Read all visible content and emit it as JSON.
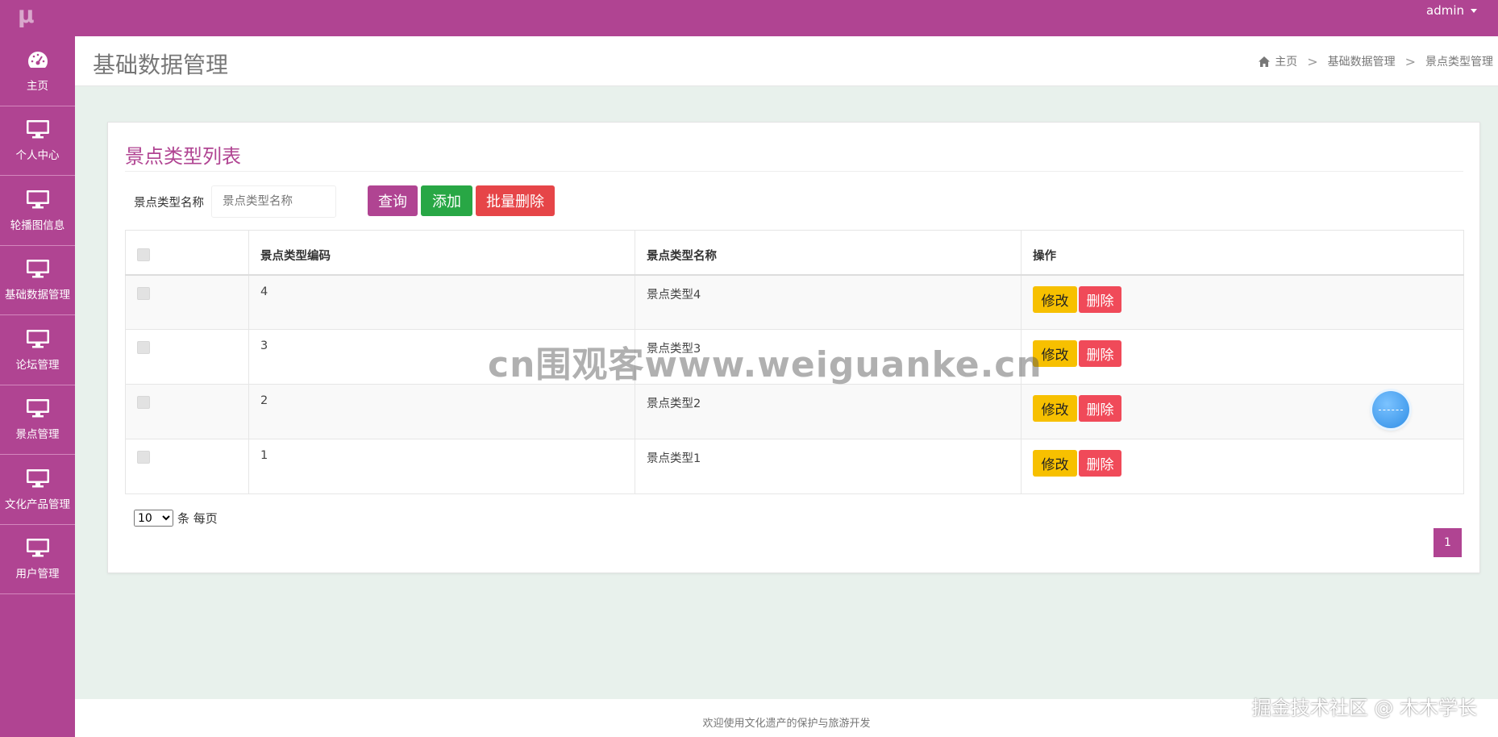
{
  "app": {
    "logo": "μ",
    "user": "admin"
  },
  "sidebar": {
    "items": [
      {
        "label": "主页",
        "icon": "dashboard-icon"
      },
      {
        "label": "个人中心",
        "icon": "monitor-icon"
      },
      {
        "label": "轮播图信息",
        "icon": "monitor-icon"
      },
      {
        "label": "基础数据管理",
        "icon": "monitor-icon"
      },
      {
        "label": "论坛管理",
        "icon": "monitor-icon"
      },
      {
        "label": "景点管理",
        "icon": "monitor-icon"
      },
      {
        "label": "文化产品管理",
        "icon": "monitor-icon"
      },
      {
        "label": "用户管理",
        "icon": "monitor-icon"
      }
    ]
  },
  "header": {
    "title": "基础数据管理",
    "breadcrumb": {
      "home": "主页",
      "level1": "基础数据管理",
      "level2": "景点类型管理",
      "separator": ">"
    }
  },
  "card": {
    "title": "景点类型列表",
    "search": {
      "label": "景点类型名称",
      "placeholder": "景点类型名称"
    },
    "buttons": {
      "query": "查询",
      "add": "添加",
      "batch_delete": "批量删除"
    },
    "table": {
      "headers": {
        "code": "景点类型编码",
        "name": "景点类型名称",
        "ops": "操作"
      },
      "rows": [
        {
          "code": "4",
          "name": "景点类型4"
        },
        {
          "code": "3",
          "name": "景点类型3"
        },
        {
          "code": "2",
          "name": "景点类型2"
        },
        {
          "code": "1",
          "name": "景点类型1"
        }
      ],
      "edit_label": "修改",
      "delete_label": "删除"
    },
    "pagination": {
      "page_size": "10",
      "page_size_options": [
        "10"
      ],
      "suffix": "条 每页",
      "current_page": "1"
    }
  },
  "footer": {
    "text": "欢迎使用文化遗产的保护与旅游开发"
  },
  "watermark": "cn围观客www.weiguanke.cn",
  "corner_mark": "掘金技术社区 @ 木木学长",
  "colors": {
    "brand": "#b04492",
    "add": "#28a745",
    "danger": "#e64548",
    "edit": "#f7c000",
    "delete": "#f04a59"
  }
}
